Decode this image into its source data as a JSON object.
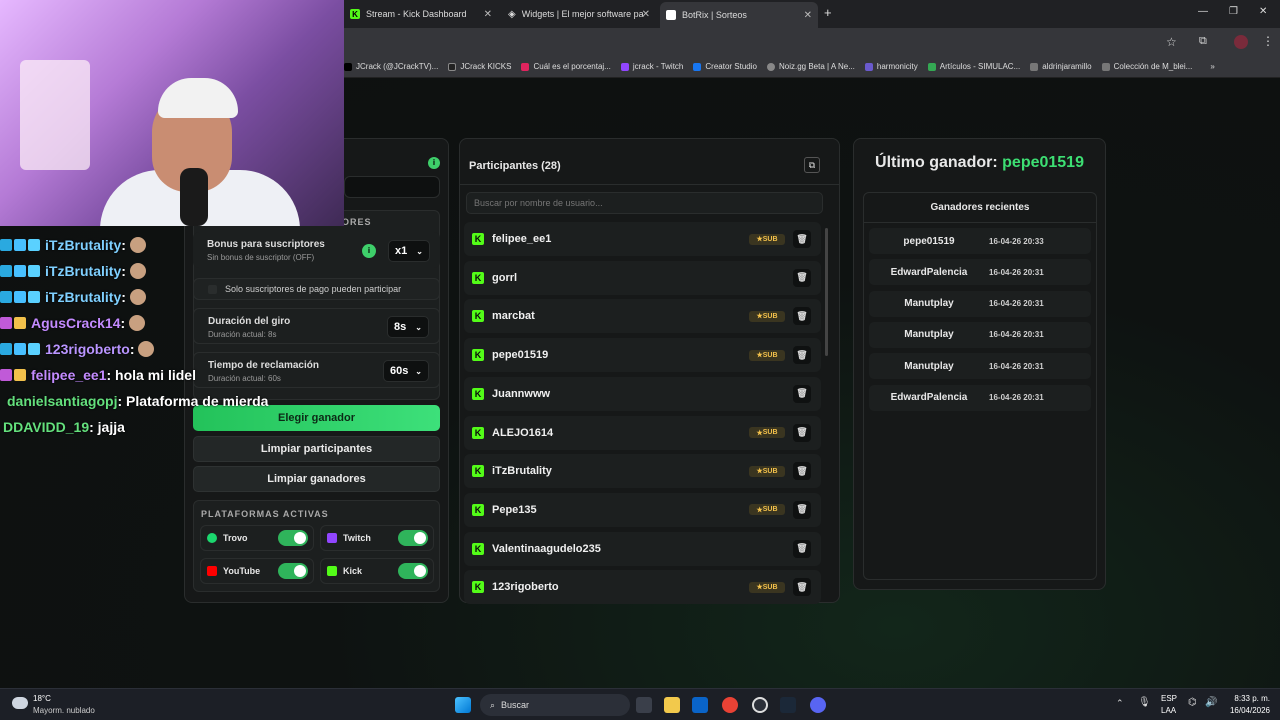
{
  "browser": {
    "tabs": [
      {
        "label": "Stream - Kick Dashboard"
      },
      {
        "label": "Widgets | El mejor software pa"
      },
      {
        "label": "BotRix | Sorteos"
      }
    ],
    "bookmarks": [
      "JCrack (@JCrackTV)...",
      "JCrack KICKS",
      "Cuál es el porcentaj...",
      "jcrack - Twitch",
      "Creator Studio",
      "Noiz.gg Beta | A Ne...",
      "harmonicity",
      "Artículos - SIMULAC...",
      "aldrinjaramillo",
      "Colección de M_blei..."
    ]
  },
  "chat": [
    {
      "user": "iTzBrutality",
      "msg": " :",
      "color": "#7fd0ff"
    },
    {
      "user": "iTzBrutality",
      "msg": " :",
      "color": "#7fd0ff"
    },
    {
      "user": "iTzBrutality",
      "msg": " :",
      "color": "#7fd0ff"
    },
    {
      "user": "AgusCrack14",
      "msg": " :",
      "color": "#c38bff"
    },
    {
      "user": "123rigoberto",
      "msg": " :",
      "color": "#b995ff"
    },
    {
      "user": "felipee_ee1",
      "msg": " : hola mi lidel",
      "color": "#c38bff"
    },
    {
      "user": "danielsantiagopj",
      "msg": " : Plataforma de mierda",
      "color": "#64e07d"
    },
    {
      "user": "DDAVIDD_19",
      "msg": " : jajja",
      "color": "#64e07d"
    }
  ],
  "left": {
    "section_header_partial": "ORES",
    "bonus_title": "Bonus para suscriptores",
    "bonus_sub": "Sin bonus de suscriptor (OFF)",
    "bonus_value": "x1",
    "only_subs": "Solo suscriptores de pago pueden participar",
    "spin_title": "Duración del giro",
    "spin_sub": "Duración actual: 8s",
    "spin_value": "8s",
    "claim_title": "Tiempo de reclamación",
    "claim_sub": "Duración actual: 60s",
    "claim_value": "60s",
    "btn_pick": "Elegir ganador",
    "btn_clear_participants": "Limpiar participantes",
    "btn_clear_winners": "Limpiar ganadores",
    "platforms_title": "PLATAFORMAS ACTIVAS",
    "platforms": [
      {
        "name": "Trovo",
        "enabled": true,
        "color": "#1bd76e"
      },
      {
        "name": "Twitch",
        "enabled": true,
        "color": "#9146ff"
      },
      {
        "name": "YouTube",
        "enabled": true,
        "color": "#ff0000"
      },
      {
        "name": "Kick",
        "enabled": true,
        "color": "#53fc18"
      }
    ]
  },
  "participants": {
    "title": "Participantes (28)",
    "search_placeholder": "Buscar por nombre de usuario...",
    "sub_label": "SUB",
    "items": [
      {
        "name": "felipee_ee1",
        "sub": true
      },
      {
        "name": "gorrl",
        "sub": false
      },
      {
        "name": "marcbat",
        "sub": true
      },
      {
        "name": "pepe01519",
        "sub": true
      },
      {
        "name": "Juannwww",
        "sub": false
      },
      {
        "name": "ALEJO1614",
        "sub": true
      },
      {
        "name": "iTzBrutality",
        "sub": true
      },
      {
        "name": "Pepe135",
        "sub": true
      },
      {
        "name": "Valentinaagudelo235",
        "sub": false
      },
      {
        "name": "123rigoberto",
        "sub": true
      }
    ]
  },
  "winners": {
    "last_label": "Último ganador:",
    "last_name": "pepe01519",
    "recent_title": "Ganadores recientes",
    "items": [
      {
        "name": "pepe01519",
        "date": "16-04-26 20:33"
      },
      {
        "name": "EdwardPalencia",
        "date": "16-04-26 20:31"
      },
      {
        "name": "Manutplay",
        "date": "16-04-26 20:31"
      },
      {
        "name": "Manutplay",
        "date": "16-04-26 20:31"
      },
      {
        "name": "Manutplay",
        "date": "16-04-26 20:31"
      },
      {
        "name": "EdwardPalencia",
        "date": "16-04-26 20:31"
      }
    ]
  },
  "taskbar": {
    "weather_temp": "18°C",
    "weather_desc": "Mayorm. nublado",
    "search": "Buscar",
    "lang1": "ESP",
    "lang2": "LAA",
    "time": "8:33 p. m.",
    "date": "16/04/2026"
  }
}
